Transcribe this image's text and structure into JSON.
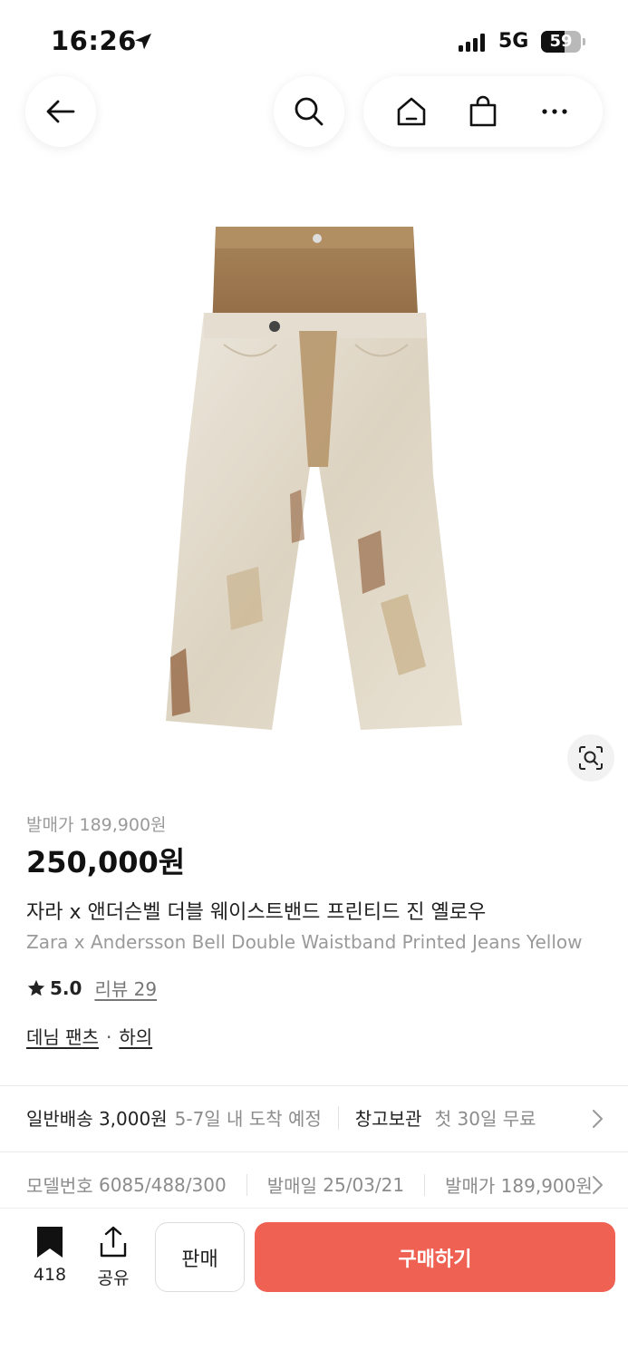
{
  "status_bar": {
    "time": "16:26",
    "network": "5G",
    "battery": "59",
    "battery_level": 0.59
  },
  "product": {
    "release_price_line": "발매가 189,900원",
    "price": "250,000원",
    "title_ko": "자라 x 앤더슨벨 더블 웨이스트밴드 프린티드 진 옐로우",
    "title_en": "Zara x Andersson Bell Double Waistband Printed Jeans Yellow",
    "rating": "5.0",
    "review_label": "리뷰 29",
    "category_1": "데님 팬츠",
    "category_sep": "·",
    "category_2": "하의"
  },
  "delivery": {
    "standard_label": "일반배송 3,000원",
    "standard_eta": "5-7일 내 도착 예정",
    "storage_label": "창고보관",
    "storage_note": "첫 30일 무료"
  },
  "specs": {
    "model_label": "모델번호",
    "model_value": "6085/488/300",
    "release_date_label": "발매일",
    "release_date_value": "25/03/21",
    "release_price_label": "발매가",
    "release_price_value": "189,900원"
  },
  "bottom_bar": {
    "bookmark_count": "418",
    "share_label": "공유",
    "sell_label": "판매",
    "buy_label": "구매하기"
  },
  "colors": {
    "buy": "#ef6253",
    "text": "#222222",
    "muted": "#9a9a9a"
  },
  "icons": [
    "location-arrow-icon",
    "signal-icon",
    "battery-icon",
    "back-arrow-icon",
    "search-icon",
    "home-icon",
    "shopping-bag-icon",
    "more-icon",
    "lens-search-icon",
    "star-icon",
    "chevron-right-icon",
    "bookmark-icon",
    "share-icon"
  ]
}
